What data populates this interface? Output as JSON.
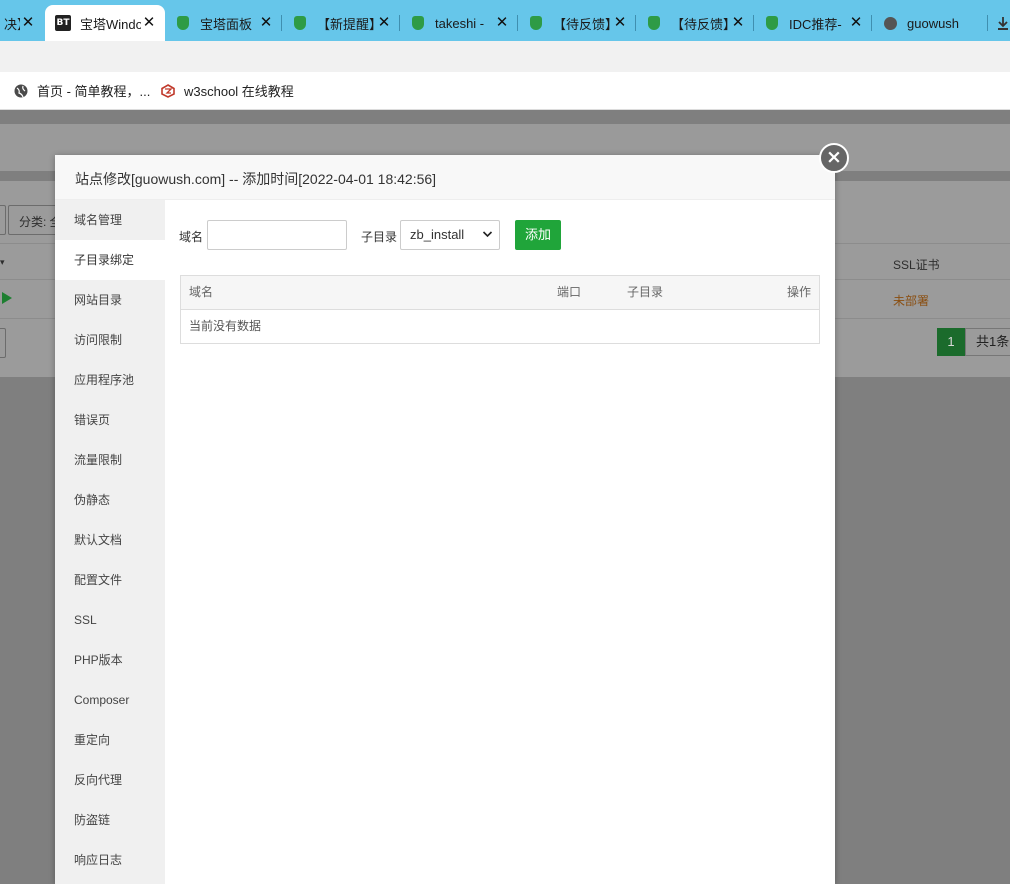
{
  "browser": {
    "tabs": [
      {
        "title": "决】",
        "icon": "none",
        "active": false
      },
      {
        "title": "宝塔Windo",
        "icon": "bt-logo",
        "active": true
      },
      {
        "title": "宝塔面板",
        "icon": "shield",
        "active": false
      },
      {
        "title": "【新提醒】",
        "icon": "shield",
        "active": false
      },
      {
        "title": "takeshi -",
        "icon": "shield",
        "active": false
      },
      {
        "title": "【待反馈】",
        "icon": "shield",
        "active": false
      },
      {
        "title": "【待反馈】",
        "icon": "shield",
        "active": false
      },
      {
        "title": "IDC推荐-",
        "icon": "shield",
        "active": false
      },
      {
        "title": "guowush",
        "icon": "globe",
        "active": false
      }
    ],
    "bookmarks": [
      {
        "label": "首页 - 简单教程，...",
        "icon": "globe-icon"
      },
      {
        "label": "w3school 在线教程",
        "icon": "w3school-icon"
      }
    ],
    "favicon_text": "BT"
  },
  "background": {
    "category_label": "分类: 全",
    "ssl_header": "SSL证书",
    "ssl_status": "未部署",
    "page_current": "1",
    "page_total": "共1条"
  },
  "modal": {
    "title": "站点修改[guowush.com] -- 添加时间[2022-04-01 18:42:56]",
    "close_glyph": "×",
    "sidebar": [
      "域名管理",
      "子目录绑定",
      "网站目录",
      "访问限制",
      "应用程序池",
      "错误页",
      "流量限制",
      "伪静态",
      "默认文档",
      "配置文件",
      "SSL",
      "PHP版本",
      "Composer",
      "重定向",
      "反向代理",
      "防盗链",
      "响应日志"
    ],
    "active_index": 1,
    "form": {
      "domain_label": "域名",
      "domain_value": "",
      "subdir_label": "子目录",
      "subdir_selected": "zb_install",
      "add_label": "添加"
    },
    "table": {
      "headers": [
        "域名",
        "端口",
        "子目录",
        "操作"
      ],
      "empty_text": "当前没有数据"
    }
  },
  "colors": {
    "tabstrip": "#66c6ea",
    "accent_green": "#20a53a",
    "ssl_warning": "#c0741c"
  }
}
